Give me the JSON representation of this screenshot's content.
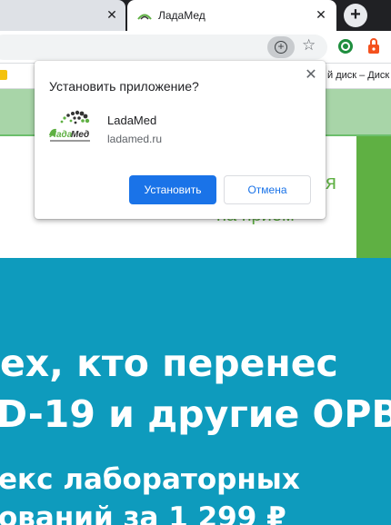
{
  "tabs": {
    "prev": {
      "close_glyph": "✕"
    },
    "active": {
      "title": "ЛадаМед",
      "favicon": "ladamed-favicon",
      "close_glyph": "✕"
    },
    "new_tab_glyph": "+"
  },
  "toolbar": {
    "install_icon": "install-app-icon",
    "install_glyph": "+",
    "star_glyph": "☆",
    "extensions": [
      "green-circle-extension-icon",
      "orange-lock-extension-icon"
    ]
  },
  "bookmarks": {
    "visible_text": "й диск – Диск"
  },
  "page": {
    "behind_line1": "я",
    "behind_line2": "на приём",
    "hero_line1": "ех, кто перенес",
    "hero_line2": "D-19 и другие ОРВ",
    "hero_line3": "екс лабораторных",
    "hero_line4": "ований за 1 299 ₽"
  },
  "dialog": {
    "title": "Установить приложение?",
    "close_glyph": "✕",
    "app_name": "LadaMed",
    "app_url": "ladamed.ru",
    "install_label": "Установить",
    "cancel_label": "Отмена"
  },
  "colors": {
    "accent": "#1a73e8",
    "banner": "#0e9bbd",
    "brand_green": "#5fb043"
  }
}
